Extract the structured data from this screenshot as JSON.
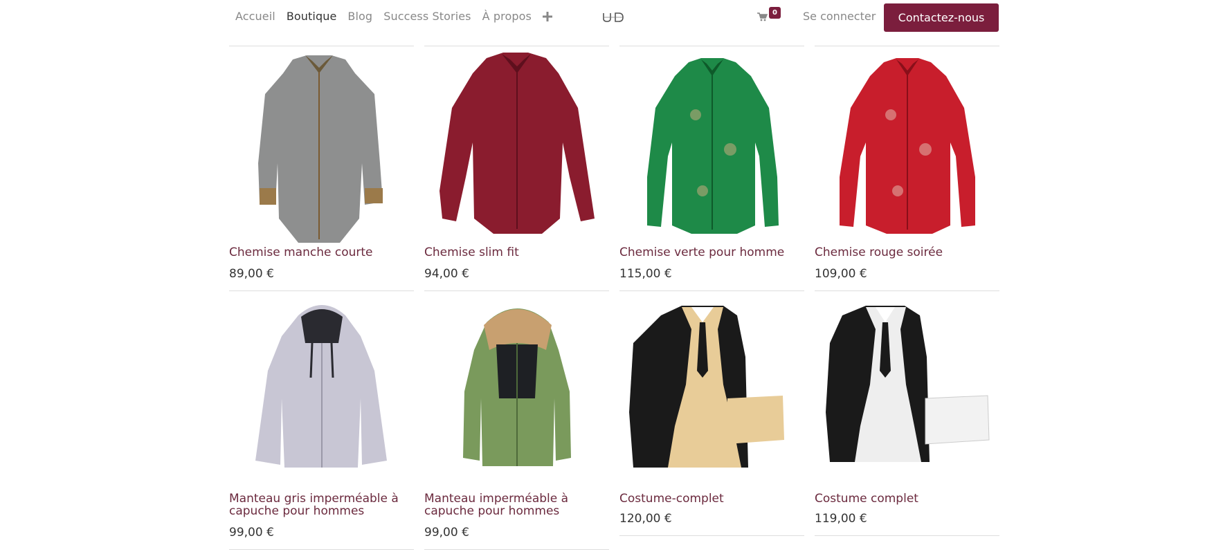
{
  "nav": {
    "links": [
      "Accueil",
      "Boutique",
      "Blog",
      "Success Stories",
      "À propos"
    ],
    "active_index": 1,
    "plus_icon": "plus-icon",
    "logo_icon": "brand-logo-icon",
    "cart_icon": "shopping-cart-icon",
    "cart_count": "0",
    "login_label": "Se connecter",
    "contact_label": "Contactez-nous"
  },
  "colors": {
    "brand": "#7b1e3d",
    "title": "#6b2a3e"
  },
  "products": [
    {
      "title": "Chemise manche courte",
      "price": "89,00 €",
      "image": "grey-shirt"
    },
    {
      "title": "Chemise slim fit",
      "price": "94,00 €",
      "image": "burgundy-shirt"
    },
    {
      "title": "Chemise verte pour homme",
      "price": "115,00 €",
      "image": "green-shirt"
    },
    {
      "title": "Chemise rouge soirée",
      "price": "109,00 €",
      "image": "red-shirt"
    },
    {
      "title": "Manteau gris  imperméable à\ncapuche  pour hommes",
      "price": "99,00 €",
      "image": "grey-hooded-jacket"
    },
    {
      "title": "Manteau  imperméable à\ncapuche  pour hommes",
      "price": "99,00 €",
      "image": "green-parka"
    },
    {
      "title": "Costume-complet",
      "price": "120,00 €",
      "image": "black-beige-suit"
    },
    {
      "title": "Costume complet",
      "price": "119,00 €",
      "image": "black-white-suit"
    }
  ]
}
